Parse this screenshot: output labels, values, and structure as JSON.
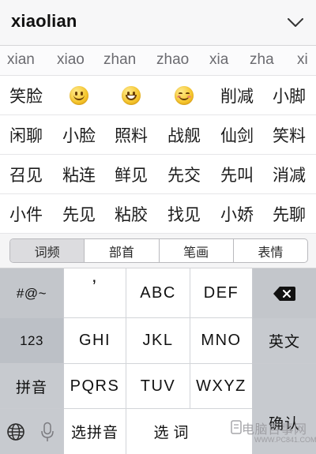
{
  "composition": {
    "text": "xiaolian"
  },
  "collapse_icon": "chevron-down-icon",
  "pinyin_options": [
    "xian",
    "xiao",
    "zhan",
    "zhao",
    "xia",
    "zha",
    "xi"
  ],
  "candidates": [
    [
      {
        "text": "笑脸"
      },
      {
        "text": "",
        "emoji": "smile"
      },
      {
        "text": "",
        "emoji": "grin"
      },
      {
        "text": "",
        "emoji": "blush"
      },
      {
        "text": "削减"
      },
      {
        "text": "小脚"
      }
    ],
    [
      {
        "text": "闲聊"
      },
      {
        "text": "小脸"
      },
      {
        "text": "照料"
      },
      {
        "text": "战舰"
      },
      {
        "text": "仙剑"
      },
      {
        "text": "笑料"
      }
    ],
    [
      {
        "text": "召见"
      },
      {
        "text": "粘连"
      },
      {
        "text": "鲜见"
      },
      {
        "text": "先交"
      },
      {
        "text": "先叫"
      },
      {
        "text": "消减"
      }
    ],
    [
      {
        "text": "小件"
      },
      {
        "text": "先见"
      },
      {
        "text": "粘胶"
      },
      {
        "text": "找见"
      },
      {
        "text": "小娇"
      },
      {
        "text": "先聊"
      }
    ]
  ],
  "filter_tabs": {
    "active_index": 0,
    "items": [
      "词频",
      "部首",
      "笔画",
      "表情"
    ]
  },
  "keyboard": {
    "symbols_key": "#@~",
    "numbers_key": "123",
    "pinyin_key": "拼音",
    "globe_icon": "globe-icon",
    "mic_icon": "microphone-icon",
    "delete_icon": "backspace-icon",
    "english_key": "英文",
    "confirm_key": "确认",
    "letter_keys": [
      [
        "’",
        "ABC",
        "DEF"
      ],
      [
        "GHI",
        "JKL",
        "MNO"
      ],
      [
        "PQRS",
        "TUV",
        "WXYZ"
      ]
    ],
    "select_pinyin_key": "选拼音",
    "select_word_key": "选词"
  },
  "watermark": {
    "text": "电脑百事网",
    "subtext": "WWW.PC841.COM"
  }
}
